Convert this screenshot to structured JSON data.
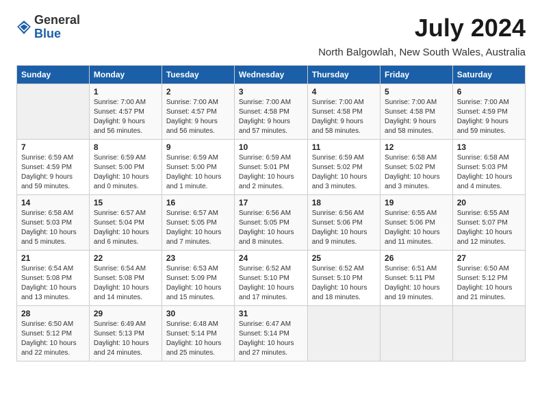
{
  "logo": {
    "general": "General",
    "blue": "Blue"
  },
  "title": "July 2024",
  "subtitle": "North Balgowlah, New South Wales, Australia",
  "columns": [
    "Sunday",
    "Monday",
    "Tuesday",
    "Wednesday",
    "Thursday",
    "Friday",
    "Saturday"
  ],
  "weeks": [
    [
      {
        "day": "",
        "info": ""
      },
      {
        "day": "1",
        "info": "Sunrise: 7:00 AM\nSunset: 4:57 PM\nDaylight: 9 hours\nand 56 minutes."
      },
      {
        "day": "2",
        "info": "Sunrise: 7:00 AM\nSunset: 4:57 PM\nDaylight: 9 hours\nand 56 minutes."
      },
      {
        "day": "3",
        "info": "Sunrise: 7:00 AM\nSunset: 4:58 PM\nDaylight: 9 hours\nand 57 minutes."
      },
      {
        "day": "4",
        "info": "Sunrise: 7:00 AM\nSunset: 4:58 PM\nDaylight: 9 hours\nand 58 minutes."
      },
      {
        "day": "5",
        "info": "Sunrise: 7:00 AM\nSunset: 4:58 PM\nDaylight: 9 hours\nand 58 minutes."
      },
      {
        "day": "6",
        "info": "Sunrise: 7:00 AM\nSunset: 4:59 PM\nDaylight: 9 hours\nand 59 minutes."
      }
    ],
    [
      {
        "day": "7",
        "info": "Sunrise: 6:59 AM\nSunset: 4:59 PM\nDaylight: 9 hours\nand 59 minutes."
      },
      {
        "day": "8",
        "info": "Sunrise: 6:59 AM\nSunset: 5:00 PM\nDaylight: 10 hours\nand 0 minutes."
      },
      {
        "day": "9",
        "info": "Sunrise: 6:59 AM\nSunset: 5:00 PM\nDaylight: 10 hours\nand 1 minute."
      },
      {
        "day": "10",
        "info": "Sunrise: 6:59 AM\nSunset: 5:01 PM\nDaylight: 10 hours\nand 2 minutes."
      },
      {
        "day": "11",
        "info": "Sunrise: 6:59 AM\nSunset: 5:02 PM\nDaylight: 10 hours\nand 3 minutes."
      },
      {
        "day": "12",
        "info": "Sunrise: 6:58 AM\nSunset: 5:02 PM\nDaylight: 10 hours\nand 3 minutes."
      },
      {
        "day": "13",
        "info": "Sunrise: 6:58 AM\nSunset: 5:03 PM\nDaylight: 10 hours\nand 4 minutes."
      }
    ],
    [
      {
        "day": "14",
        "info": "Sunrise: 6:58 AM\nSunset: 5:03 PM\nDaylight: 10 hours\nand 5 minutes."
      },
      {
        "day": "15",
        "info": "Sunrise: 6:57 AM\nSunset: 5:04 PM\nDaylight: 10 hours\nand 6 minutes."
      },
      {
        "day": "16",
        "info": "Sunrise: 6:57 AM\nSunset: 5:05 PM\nDaylight: 10 hours\nand 7 minutes."
      },
      {
        "day": "17",
        "info": "Sunrise: 6:56 AM\nSunset: 5:05 PM\nDaylight: 10 hours\nand 8 minutes."
      },
      {
        "day": "18",
        "info": "Sunrise: 6:56 AM\nSunset: 5:06 PM\nDaylight: 10 hours\nand 9 minutes."
      },
      {
        "day": "19",
        "info": "Sunrise: 6:55 AM\nSunset: 5:06 PM\nDaylight: 10 hours\nand 11 minutes."
      },
      {
        "day": "20",
        "info": "Sunrise: 6:55 AM\nSunset: 5:07 PM\nDaylight: 10 hours\nand 12 minutes."
      }
    ],
    [
      {
        "day": "21",
        "info": "Sunrise: 6:54 AM\nSunset: 5:08 PM\nDaylight: 10 hours\nand 13 minutes."
      },
      {
        "day": "22",
        "info": "Sunrise: 6:54 AM\nSunset: 5:08 PM\nDaylight: 10 hours\nand 14 minutes."
      },
      {
        "day": "23",
        "info": "Sunrise: 6:53 AM\nSunset: 5:09 PM\nDaylight: 10 hours\nand 15 minutes."
      },
      {
        "day": "24",
        "info": "Sunrise: 6:52 AM\nSunset: 5:10 PM\nDaylight: 10 hours\nand 17 minutes."
      },
      {
        "day": "25",
        "info": "Sunrise: 6:52 AM\nSunset: 5:10 PM\nDaylight: 10 hours\nand 18 minutes."
      },
      {
        "day": "26",
        "info": "Sunrise: 6:51 AM\nSunset: 5:11 PM\nDaylight: 10 hours\nand 19 minutes."
      },
      {
        "day": "27",
        "info": "Sunrise: 6:50 AM\nSunset: 5:12 PM\nDaylight: 10 hours\nand 21 minutes."
      }
    ],
    [
      {
        "day": "28",
        "info": "Sunrise: 6:50 AM\nSunset: 5:12 PM\nDaylight: 10 hours\nand 22 minutes."
      },
      {
        "day": "29",
        "info": "Sunrise: 6:49 AM\nSunset: 5:13 PM\nDaylight: 10 hours\nand 24 minutes."
      },
      {
        "day": "30",
        "info": "Sunrise: 6:48 AM\nSunset: 5:14 PM\nDaylight: 10 hours\nand 25 minutes."
      },
      {
        "day": "31",
        "info": "Sunrise: 6:47 AM\nSunset: 5:14 PM\nDaylight: 10 hours\nand 27 minutes."
      },
      {
        "day": "",
        "info": ""
      },
      {
        "day": "",
        "info": ""
      },
      {
        "day": "",
        "info": ""
      }
    ]
  ]
}
